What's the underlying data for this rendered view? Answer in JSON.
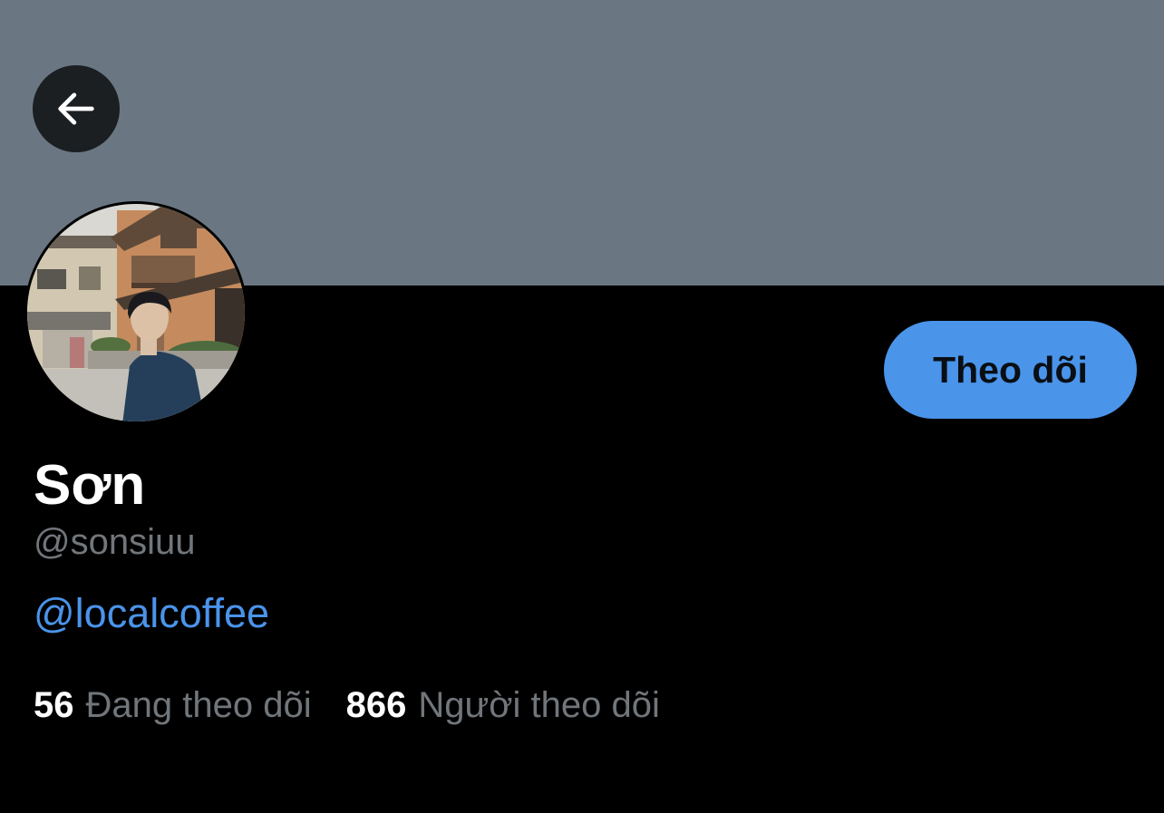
{
  "colors": {
    "banner": "#6a7682",
    "background": "#000000",
    "accent": "#4a94ea",
    "secondary_text": "#71767b",
    "back_button_bg": "#1b1f22"
  },
  "header": {
    "back_icon": "arrow-left-icon"
  },
  "profile": {
    "follow_label": "Theo dõi",
    "display_name": "Sơn",
    "handle": "@sonsiuu",
    "bio_link": "@localcoffee"
  },
  "stats": {
    "following_count": "56",
    "following_label": "Đang theo dõi",
    "followers_count": "866",
    "followers_label": "Người theo dõi"
  }
}
